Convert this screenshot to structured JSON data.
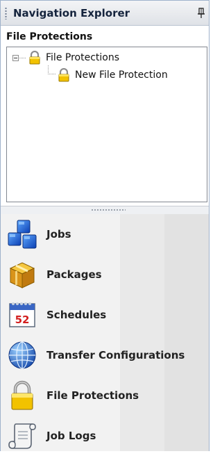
{
  "panel": {
    "title": "Navigation Explorer",
    "pin_icon": "pin-icon"
  },
  "section_header": "File Protections",
  "tree": {
    "root": {
      "label": "File Protections",
      "icon": "lock-icon",
      "expanded": true
    },
    "children": [
      {
        "label": "New File Protection",
        "icon": "lock-icon"
      }
    ]
  },
  "nav_items": [
    {
      "label": "Jobs",
      "icon": "blue-cubes-icon"
    },
    {
      "label": "Packages",
      "icon": "package-box-icon"
    },
    {
      "label": "Schedules",
      "icon": "calendar-icon"
    },
    {
      "label": "Transfer Configurations",
      "icon": "globe-icon"
    },
    {
      "label": "File Protections",
      "icon": "padlock-icon"
    },
    {
      "label": "Job Logs",
      "icon": "scroll-icon"
    }
  ]
}
